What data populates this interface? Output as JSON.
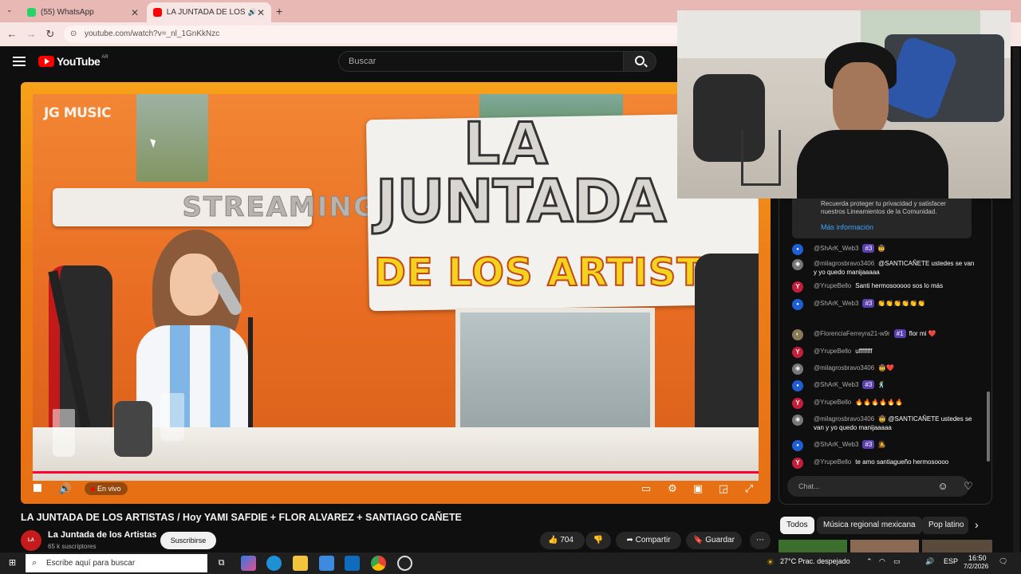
{
  "browser": {
    "tabs": [
      {
        "label": "(55) WhatsApp",
        "active": false
      },
      {
        "label": "LA JUNTADA DE LOS ARTISTAS",
        "active": true
      }
    ],
    "url": "youtube.com/watch?v=_nl_1GnKkNzc"
  },
  "youtube": {
    "logo_text": "YouTube",
    "region": "AR",
    "search_placeholder": "Buscar"
  },
  "video": {
    "watermark": "JG MUSIC",
    "sign_streaming": "STREAMING",
    "sign_la": "LA",
    "sign_juntada": "JUNTADA",
    "sign_de_los": "DE LOS ARTISTAS",
    "live_label": "En vivo",
    "title": "LA JUNTADA DE LOS ARTISTAS / Hoy YAMI SAFDIE + FLOR ALVAREZ + SANTIAGO CAÑETE"
  },
  "channel": {
    "name": "La Juntada de los Artistas",
    "subscribers": "65 k suscriptores",
    "subscribe_label": "Suscribirse",
    "avatar_text": "LA JUNTADA"
  },
  "actions": {
    "likes": "704",
    "share": "Compartir",
    "save": "Guardar"
  },
  "chat": {
    "notice_text": "Recuerda proteger tu privacidad y satisfacer nuestros Lineamientos de la Comunidad.",
    "notice_link": "Más información",
    "input_placeholder": "Chat...",
    "messages": [
      {
        "user": "@ShArK_Web3",
        "badge": "#3",
        "text": "🤠",
        "avatar_color": "#1e5fd6",
        "initial": "●"
      },
      {
        "user": "@milagrosbravo3406",
        "badge": "",
        "text": "@SANTICAÑETE ustedes se van y yo quedo manijaaaaa",
        "avatar_color": "#777777",
        "initial": "◉"
      },
      {
        "user": "@YrupeBello",
        "badge": "",
        "text": "Santi hermosooooo sos lo más",
        "avatar_color": "#c41e3a",
        "initial": "Y"
      },
      {
        "user": "@ShArK_Web3",
        "badge": "#3",
        "text": "👏👏👏👏👏👏",
        "avatar_color": "#1e5fd6",
        "initial": "●"
      },
      {
        "user": "@FlorenciaFerreyra21-w9r",
        "badge": "#1",
        "text": "flor mi ❤️",
        "avatar_color": "#8a7a5a",
        "initial": "◐"
      },
      {
        "user": "@YrupeBello",
        "badge": "",
        "text": "uffffffff",
        "avatar_color": "#c41e3a",
        "initial": "Y"
      },
      {
        "user": "@milagrosbravo3406",
        "badge": "",
        "text": "🤠❤️",
        "avatar_color": "#777777",
        "initial": "◉"
      },
      {
        "user": "@ShArK_Web3",
        "badge": "#3",
        "text": "🕺",
        "avatar_color": "#1e5fd6",
        "initial": "●"
      },
      {
        "user": "@YrupeBello",
        "badge": "",
        "text": "🔥🔥🔥🔥🔥🔥",
        "avatar_color": "#c41e3a",
        "initial": "Y"
      },
      {
        "user": "@milagrosbravo3406",
        "badge": "",
        "text": "🤠 @SANTICAÑETE ustedes se van y yo quedo manijaaaaa",
        "avatar_color": "#777777",
        "initial": "◉"
      },
      {
        "user": "@ShArK_Web3",
        "badge": "#3",
        "text": "🧑‍🎤",
        "avatar_color": "#1e5fd6",
        "initial": "●"
      },
      {
        "user": "@YrupeBello",
        "badge": "",
        "text": "te amo santiagueño hermosoooo",
        "avatar_color": "#c41e3a",
        "initial": "Y"
      }
    ]
  },
  "chips": [
    "Todos",
    "Música regional mexicana",
    "Pop latino"
  ],
  "taskbar": {
    "search_placeholder": "Escribe aquí para buscar",
    "weather": "27°C  Prac. despejado",
    "language": "ESP",
    "time": "16:50",
    "date": "7/2/2026"
  }
}
